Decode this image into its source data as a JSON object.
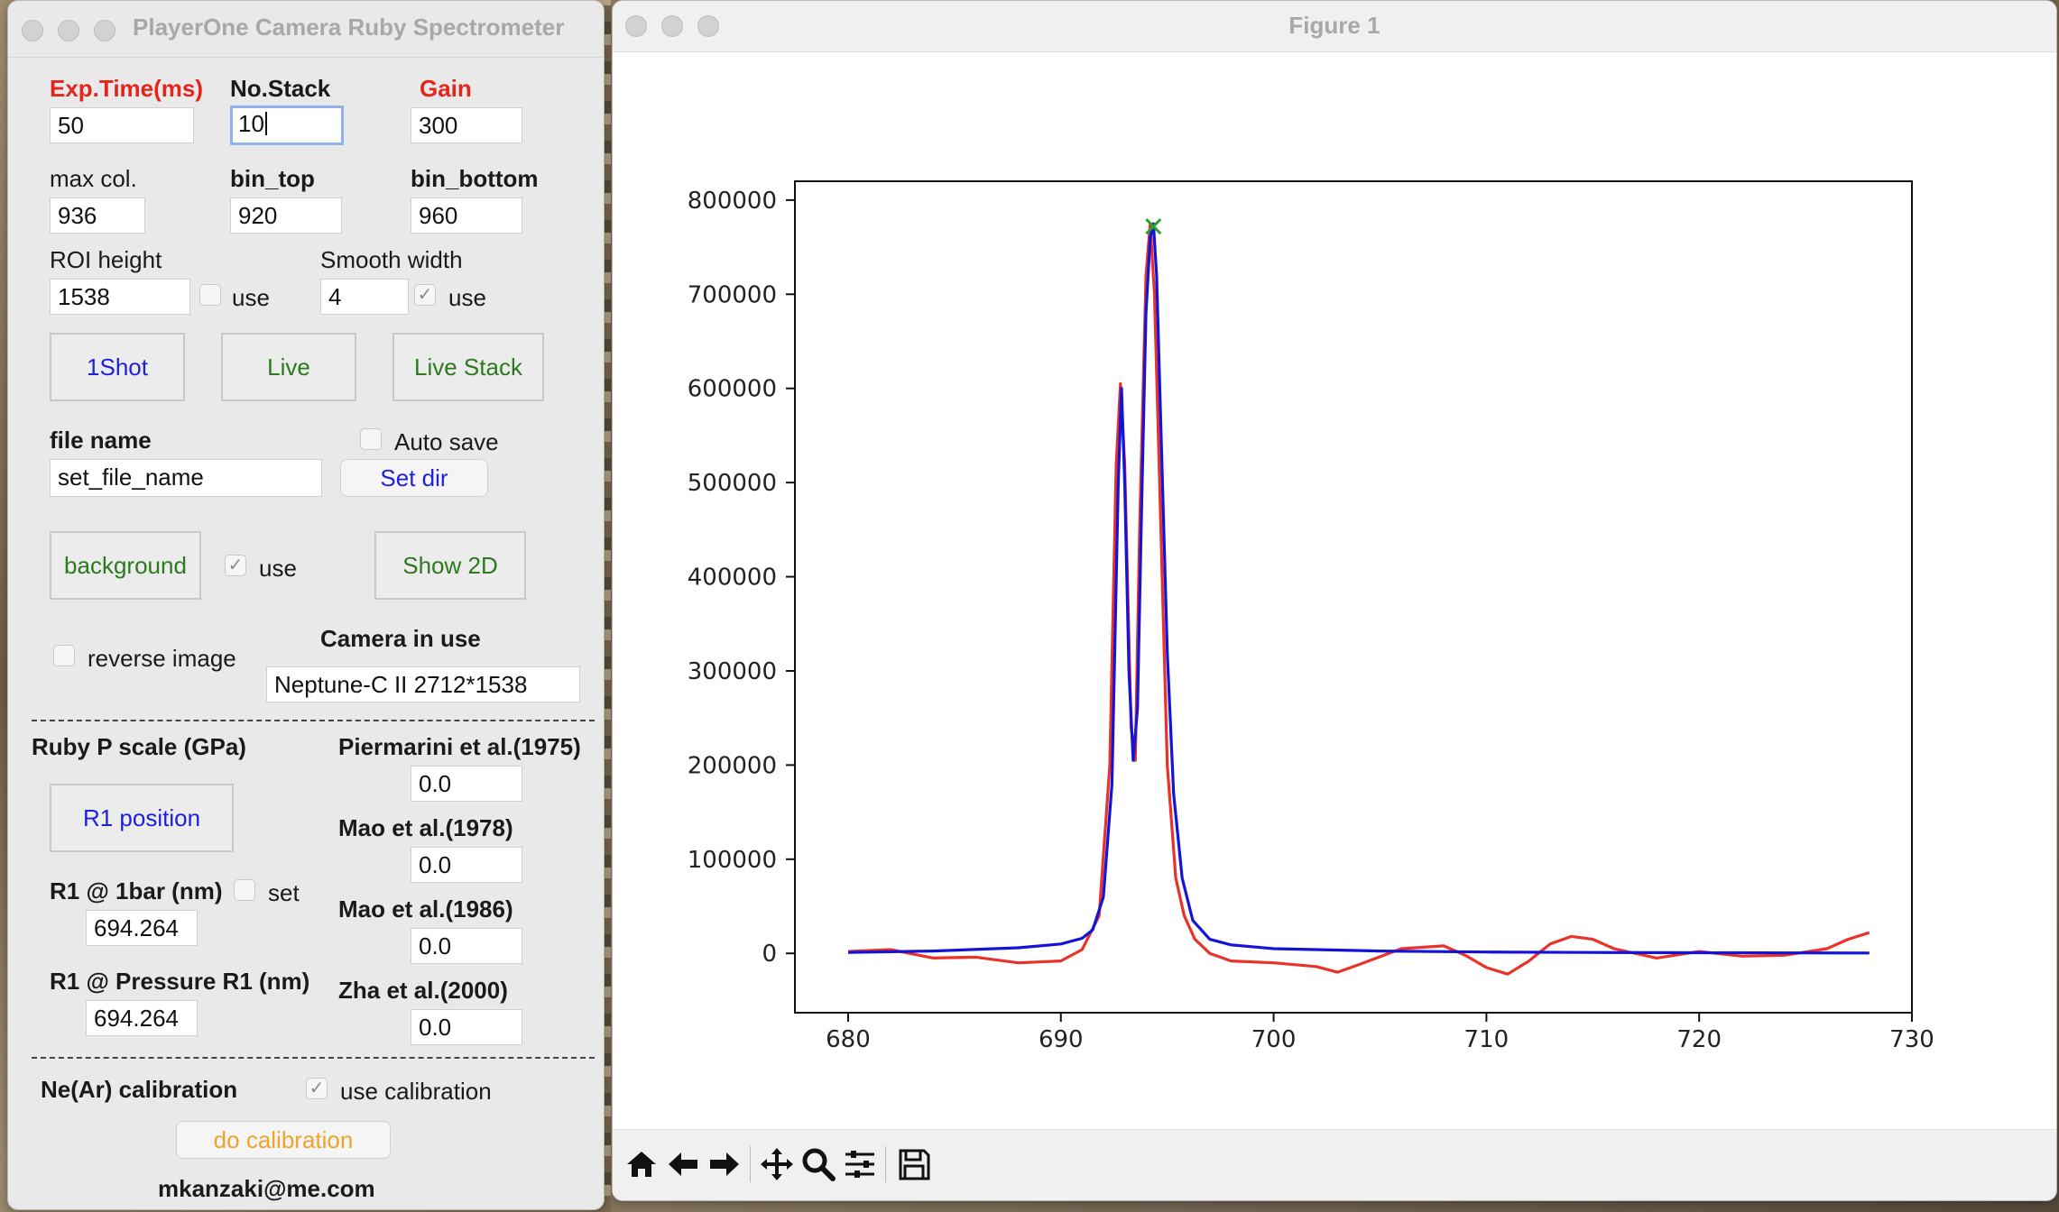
{
  "control_window": {
    "title": "PlayerOne Camera Ruby Spectrometer",
    "exposure": {
      "label": "Exp.Time(ms)",
      "value": "50"
    },
    "stack": {
      "label": "No.Stack",
      "value": "10"
    },
    "gain": {
      "label": "Gain",
      "value": "300"
    },
    "max_col": {
      "label": "max col.",
      "value": "936"
    },
    "bin_top": {
      "label": "bin_top",
      "value": "920"
    },
    "bin_bottom": {
      "label": "bin_bottom",
      "value": "960"
    },
    "roi_height": {
      "label": "ROI height",
      "value": "1538",
      "use_label": "use",
      "use_checked": false
    },
    "smooth_width": {
      "label": "Smooth width",
      "value": "4",
      "use_label": "use",
      "use_checked": true
    },
    "buttons": {
      "one_shot": "1Shot",
      "live": "Live",
      "live_stack": "Live Stack"
    },
    "file": {
      "label": "file name",
      "value": "set_file_name",
      "auto_save_label": "Auto save",
      "set_dir": "Set dir"
    },
    "background": {
      "button": "background",
      "use_label": "use",
      "show_2d": "Show 2D"
    },
    "reverse_image_label": "reverse image",
    "camera": {
      "label": "Camera in use",
      "value": "Neptune-C II 2712*1538"
    },
    "ruby": {
      "title": "Ruby P scale (GPa)",
      "r1_position": "R1 position",
      "r1_1bar_label": "R1 @ 1bar (nm)",
      "r1_1bar_value": "694.264",
      "set_label": "set",
      "r1_pressure_label": "R1 @ Pressure R1 (nm)",
      "r1_pressure_value": "694.264",
      "scales": [
        {
          "label": "Piermarini et al.(1975)",
          "value": "0.0"
        },
        {
          "label": "Mao et al.(1978)",
          "value": "0.0"
        },
        {
          "label": "Mao et al.(1986)",
          "value": "0.0"
        },
        {
          "label": "Zha et al.(2000)",
          "value": "0.0"
        }
      ]
    },
    "calibration": {
      "title": "Ne(Ar) calibration",
      "use_label": "use calibration",
      "button": "do calibration"
    },
    "email": "mkanzaki@me.com"
  },
  "figure_window": {
    "title": "Figure 1",
    "toolbar_icons": [
      "home-icon",
      "back-arrow-icon",
      "forward-arrow-icon",
      "pan-icon",
      "zoom-icon",
      "configure-icon",
      "save-icon"
    ]
  },
  "chart_data": {
    "type": "line",
    "title": "",
    "xlabel": "",
    "ylabel": "",
    "xlim": [
      677.5,
      730
    ],
    "ylim": [
      -63000,
      820000
    ],
    "x_ticks": [
      680,
      690,
      700,
      710,
      720,
      730
    ],
    "y_ticks": [
      0,
      100000,
      200000,
      300000,
      400000,
      500000,
      600000,
      700000,
      800000
    ],
    "grid": false,
    "legend": "none",
    "series": [
      {
        "color": "#e8322a",
        "x": [
          680,
          682,
          684,
          686,
          688,
          690,
          691,
          691.8,
          692.3,
          692.6,
          692.8,
          693.0,
          693.3,
          693.5,
          693.7,
          694.0,
          694.2,
          694.4,
          694.7,
          695.0,
          695.4,
          695.8,
          696.3,
          697,
          698,
          700,
          702,
          703,
          704,
          706,
          708,
          709,
          710,
          711,
          712,
          713,
          714,
          715,
          716,
          718,
          720,
          722,
          724,
          726,
          727,
          728
        ],
        "y": [
          2000,
          4000,
          -5000,
          -4000,
          -10000,
          -8000,
          4000,
          40000,
          200000,
          520000,
          605000,
          520000,
          240000,
          205000,
          450000,
          720000,
          775000,
          700000,
          450000,
          200000,
          80000,
          40000,
          15000,
          0,
          -8000,
          -10000,
          -14000,
          -20000,
          -12000,
          5000,
          8000,
          -2000,
          -15000,
          -22000,
          -8000,
          10000,
          18000,
          15000,
          5000,
          -5000,
          2000,
          -3000,
          -2000,
          5000,
          15000,
          22000
        ]
      },
      {
        "color": "#1414d8",
        "x": [
          680,
          684,
          688,
          690,
          691,
          691.5,
          692,
          692.4,
          692.7,
          692.85,
          693.0,
          693.2,
          693.4,
          693.6,
          693.8,
          694.0,
          694.2,
          694.35,
          694.5,
          694.7,
          695.0,
          695.3,
          695.7,
          696.2,
          697,
          698,
          700,
          705,
          710,
          715,
          720,
          725,
          728
        ],
        "y": [
          1000,
          2500,
          6000,
          10000,
          16000,
          25000,
          60000,
          180000,
          500000,
          600000,
          500000,
          300000,
          205000,
          260000,
          480000,
          680000,
          760000,
          775000,
          720000,
          560000,
          320000,
          170000,
          80000,
          35000,
          15000,
          9000,
          5000,
          2500,
          1500,
          1000,
          700,
          500,
          400
        ]
      }
    ],
    "peak_marker": {
      "x": 694.35,
      "y": 772000,
      "color": "#2ca02c",
      "symbol": "x"
    }
  }
}
